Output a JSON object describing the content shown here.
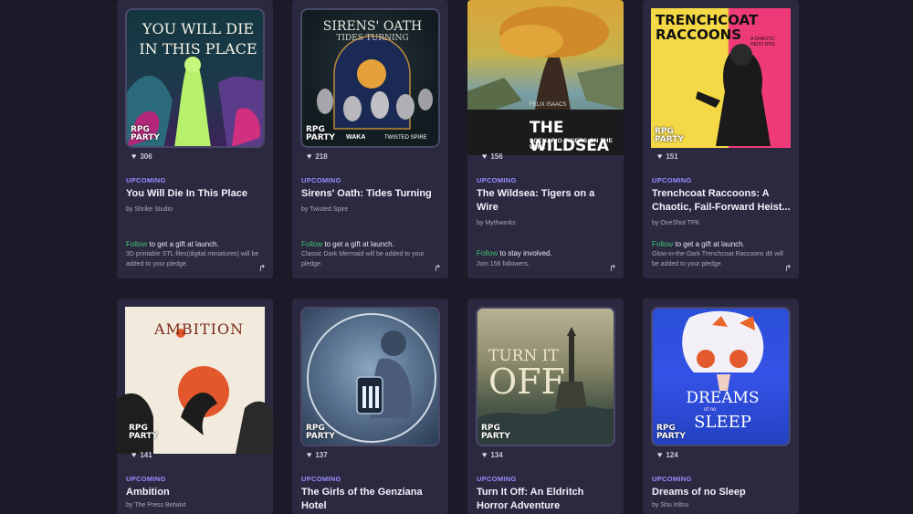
{
  "cards": [
    {
      "art_title": "YOU WILL DIE IN THIS PLACE",
      "likes": "306",
      "status": "UPCOMING",
      "title": "You Will Die In This Place",
      "creator": "by Shrike Studio",
      "follow_word": "Follow",
      "follow_rest": " to get a gift at launch.",
      "desc": "3D printable STL files(digital miniatures) will be added to your pledge."
    },
    {
      "art_title": "SIRENS' OATH",
      "art_subtitle": "TIDES TURNING",
      "art_logo_1": "WAKA",
      "art_logo_2": "TWISTED SPIRE",
      "likes": "218",
      "status": "UPCOMING",
      "title": "Sirens' Oath: Tides Turning",
      "creator": "by Twisted Spire",
      "follow_word": "Follow",
      "follow_rest": " to get a gift at launch.",
      "desc": "Classic Dark Mermaid will be added to your pledge."
    },
    {
      "art_title": "THE WILDSEA",
      "art_subtitle": "SCENARIO  TIGERS ON THE WIRE",
      "art_author": "FELIX ISAACS",
      "likes": "156",
      "status": "UPCOMING",
      "title": "The Wildsea: Tigers on a Wire",
      "creator": "by Mythworks",
      "follow_word": "Follow",
      "follow_rest": " to stay involved.",
      "desc": "Join 156 followers."
    },
    {
      "art_title": "TRENCHCOAT RACCOONS",
      "art_subtitle": "A CHAOTIC HEIST RPG",
      "likes": "151",
      "status": "UPCOMING",
      "title": "Trenchcoat Raccoons: A Chaotic, Fail-Forward Heist...",
      "creator": "by OneShot TPK",
      "follow_word": "Follow",
      "follow_rest": " to get a gift at launch.",
      "desc": "Glow-in-the-Dark Trenchcoat Raccoons d6 will be added to your pledge."
    },
    {
      "art_title": "AMBITION",
      "likes": "141",
      "status": "UPCOMING",
      "title": "Ambition",
      "creator": "by The Press Betwixt"
    },
    {
      "likes": "137",
      "status": "UPCOMING",
      "title": "The Girls of the Genziana Hotel"
    },
    {
      "art_title_1": "TURN IT",
      "art_title_2": "OFF",
      "likes": "134",
      "status": "UPCOMING",
      "title": "Turn It Off: An Eldritch Horror Adventure"
    },
    {
      "art_title_1": "DREAMS",
      "art_title_2": "SLEEP",
      "art_of": "of no",
      "likes": "124",
      "status": "UPCOMING",
      "title": "Dreams of no Sleep",
      "creator": "by Shu Inltsu"
    }
  ],
  "badge": {
    "line1": "RPG",
    "line2": "PARTY"
  },
  "icons": {
    "heart": "heart-icon",
    "share": "share-arrow-icon"
  },
  "colors": {
    "bg": "#1b1a29",
    "card": "#2b2940",
    "status": "#9a8cff",
    "follow": "#3ec46d"
  }
}
